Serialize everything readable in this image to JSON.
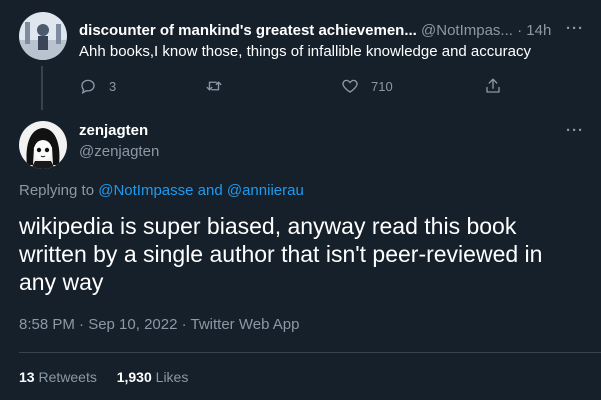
{
  "parent_tweet": {
    "display_name": "discounter of mankind's greatest achievemen...",
    "handle": "@NotImpas...",
    "separator": "·",
    "time": "14h",
    "more": "···",
    "text": "Ahh books,I know those, things of infallible knowledge and accuracy",
    "actions": {
      "reply_count": "3",
      "retweet_count": "",
      "like_count": "710",
      "icons": [
        "reply-icon",
        "retweet-icon",
        "like-icon",
        "share-icon"
      ]
    }
  },
  "main_tweet": {
    "display_name": "zenjagten",
    "handle": "@zenjagten",
    "more": "···",
    "replying_prefix": "Replying to ",
    "replying_user1": "@NotImpasse",
    "replying_and": " and ",
    "replying_user2": "@anniierau",
    "text": "wikipedia is super biased, anyway read this book written by a single author that isn't peer-reviewed in any way",
    "timestamp": "8:58 PM · Sep 10, 2022 · Twitter Web App",
    "retweets_count": "13",
    "retweets_label": "Retweets",
    "likes_count": "1,930",
    "likes_label": "Likes"
  },
  "colors": {
    "background": "#15202b",
    "text": "#ffffff",
    "muted": "#8b98a5",
    "accent": "#1d9bf0",
    "border": "#38444d"
  }
}
